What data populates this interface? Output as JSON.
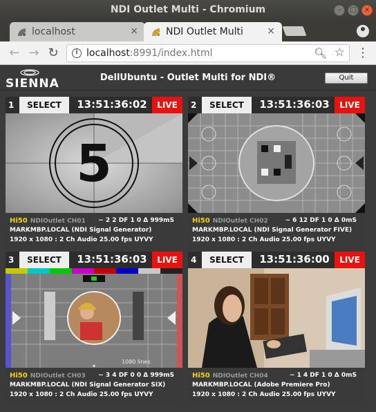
{
  "window": {
    "title": "NDI Outlet Multi - Chromium"
  },
  "tabs": [
    {
      "label": "localhost",
      "close": "×"
    },
    {
      "label": "NDI Outlet Multi",
      "close": "×"
    }
  ],
  "toolbar": {
    "url_host": "localhost",
    "url_rest": ":8991/index.html",
    "back": "←",
    "forward": "→",
    "reload": "↻"
  },
  "app": {
    "logo": "SIENNA",
    "title": "DellUbuntu - Outlet Multi for NDI®",
    "quit_label": "Quit"
  },
  "panels": [
    {
      "number": "1",
      "select_label": "SELECT",
      "time": "13:51:36:02",
      "live_label": "LIVE",
      "format": "Hi50",
      "channel": "NDIOutlet CH01",
      "stats": "~ 2 2 DF 1 0 Δ 999mS",
      "source": "MARKMBP.LOCAL (NDI Signal Generator)",
      "details": "1920 x 1080 : 2 Ch Audio 25.00 fps UYVY",
      "video_countdown": "5"
    },
    {
      "number": "2",
      "select_label": "SELECT",
      "time": "13:51:36:03",
      "live_label": "LIVE",
      "format": "Hi50",
      "channel": "NDIOutlet CH02",
      "stats": "~ 6 12 DF 1 0 Δ 0mS",
      "source": "MARKMBP.LOCAL (NDI Signal Generator FIVE)",
      "details": "1920 x 1080 : 2 Ch Audio 25.00 fps UYVY"
    },
    {
      "number": "3",
      "select_label": "SELECT",
      "time": "13:51:36:03",
      "live_label": "LIVE",
      "format": "Hi50",
      "channel": "NDIOutlet CH03",
      "stats": "~ 3 4 DF 0 0 Δ 999mS",
      "source": "MARKMBP.LOCAL (NDI Signal Generator SIX)",
      "details": "1920 x 1080 : 2 Ch Audio 25.00 fps UYVY",
      "video_caption": "1080 lines"
    },
    {
      "number": "4",
      "select_label": "SELECT",
      "time": "13:51:36:00",
      "live_label": "LIVE",
      "format": "Hi50",
      "channel": "NDIOutlet CH04",
      "stats": "~ 1 4 DF 1 0 Δ 0mS",
      "source": "MARKMBP.LOCAL (Adobe Premiere Pro)",
      "details": "1920 x 1080 : 2 Ch Audio 25.00 fps UYVY"
    }
  ]
}
